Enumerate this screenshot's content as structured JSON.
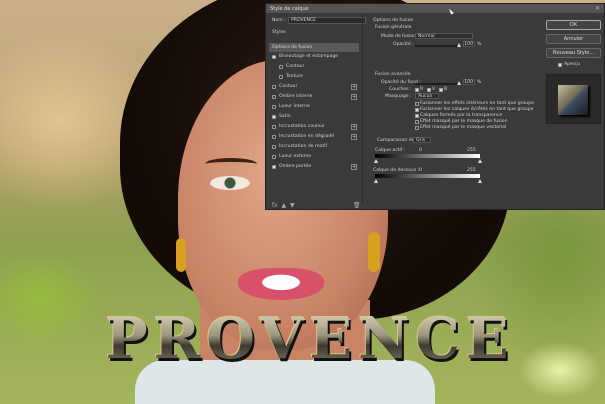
{
  "photo": {
    "headline": "PROVENCE"
  },
  "dialog": {
    "title": "Style de calque",
    "close": "✕",
    "name_label": "Nom :",
    "name_value": "PROVENCE",
    "styles_header": "Styles",
    "options_label": "Options de fusion",
    "styles": [
      {
        "label": "Biseautage et estampage",
        "checked": true,
        "plus": false,
        "indent": false
      },
      {
        "label": "Contour",
        "checked": false,
        "plus": false,
        "indent": true
      },
      {
        "label": "Texture",
        "checked": false,
        "plus": false,
        "indent": true
      },
      {
        "label": "Contour",
        "checked": false,
        "plus": true,
        "indent": false
      },
      {
        "label": "Ombre interne",
        "checked": false,
        "plus": true,
        "indent": false
      },
      {
        "label": "Lueur interne",
        "checked": false,
        "plus": false,
        "indent": false
      },
      {
        "label": "Satin",
        "checked": true,
        "plus": false,
        "indent": false
      },
      {
        "label": "Incrustation couleur",
        "checked": false,
        "plus": true,
        "indent": false
      },
      {
        "label": "Incrustation en dégradé",
        "checked": false,
        "plus": true,
        "indent": false
      },
      {
        "label": "Incrustation de motif",
        "checked": false,
        "plus": false,
        "indent": false
      },
      {
        "label": "Lueur externe",
        "checked": false,
        "plus": false,
        "indent": false
      },
      {
        "label": "Ombre portée",
        "checked": true,
        "plus": true,
        "indent": false
      }
    ],
    "blend": {
      "section": "Options de fusion",
      "general": "Fusion générale",
      "mode_label": "Mode de fusion :",
      "mode_value": "Normal",
      "opacity_label": "Opacité :",
      "opacity_value": "100",
      "percent": "%",
      "advanced": "Fusion avancée",
      "fill_label": "Opacité du fond :",
      "fill_value": "100",
      "fill_fraction": 1.0,
      "channels_label": "Couches :",
      "ch_r": "R",
      "ch_g": "V",
      "ch_b": "B",
      "knockout_label": "Masquage :",
      "knockout_value": "Aucun",
      "opt1": "Fusionner les effets intérieurs en tant que groupe",
      "opt2": "Fusionner les calques écrêtés en tant que groupe",
      "opt3": "Calques formés par la transparence",
      "opt4": "Effet masqué par le masque de fusion",
      "opt5": "Effet masqué par le masque vectoriel",
      "opt1_on": false,
      "opt2_on": true,
      "opt3_on": true,
      "opt4_on": false,
      "opt5_on": false,
      "blendif_label": "Comparaison de :",
      "blendif_value": "Gris",
      "this_layer_label": "Calque actif :",
      "this_min": "0",
      "this_max": "255",
      "under_layer_label": "Calque de dessous :",
      "under_min": "0",
      "under_max": "255"
    },
    "buttons": {
      "ok": "OK",
      "cancel": "Annuler",
      "new_style": "Nouveau Style...",
      "preview": "Aperçu"
    },
    "preview_on": true,
    "footer_icons": [
      "fx",
      "▲",
      "▼"
    ],
    "trash": "🗑"
  }
}
